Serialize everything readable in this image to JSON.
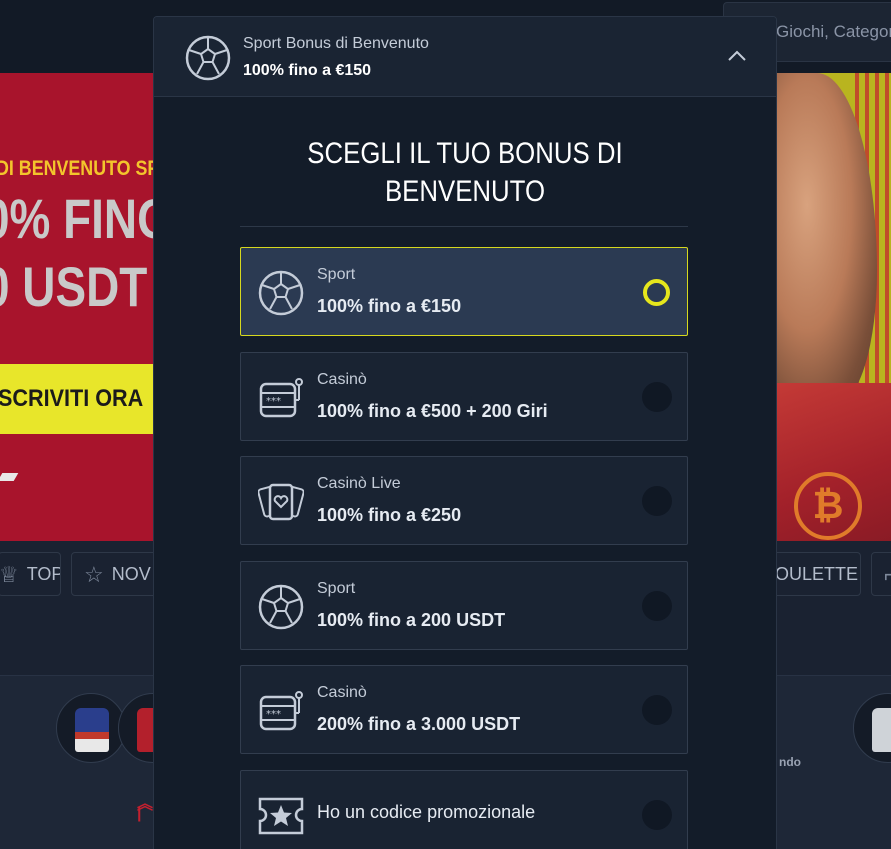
{
  "background": {
    "search_text": "Giochi, Categor",
    "banner": {
      "subtitle": "DI BENVENUTO SP",
      "line1": "0% FINO",
      "line2": "0 USDT",
      "cta": "SCRIVITI ORA"
    },
    "categories": [
      {
        "label": "TOP",
        "icon": "crown-icon"
      },
      {
        "label": "NOV",
        "icon": "star-icon"
      },
      {
        "label": "OULETTE",
        "icon": "roulette-icon"
      },
      {
        "label": "",
        "icon": "cards-icon"
      }
    ],
    "side_label": "ndo"
  },
  "modal": {
    "header": {
      "title": "Sport Bonus di Benvenuto",
      "subtitle": "100% fino a €150",
      "icon": "football-icon"
    },
    "heading_line1": "SCEGLI IL TUO BONUS DI",
    "heading_line2": "BENVENUTO",
    "options": [
      {
        "category": "Sport",
        "offer": "100% fino a €150",
        "icon": "football-icon",
        "selected": true
      },
      {
        "category": "Casinò",
        "offer": "100% fino a €500 + 200 Giri",
        "icon": "slot-machine-icon",
        "selected": false
      },
      {
        "category": "Casinò Live",
        "offer": "100% fino a €250",
        "icon": "playing-cards-icon",
        "selected": false
      },
      {
        "category": "Sport",
        "offer": "100% fino a 200 USDT",
        "icon": "football-icon",
        "selected": false
      },
      {
        "category": "Casinò",
        "offer": "200% fino a 3.000 USDT",
        "icon": "slot-machine-icon",
        "selected": false
      },
      {
        "label": "Ho un codice promozionale",
        "icon": "promo-ticket-icon",
        "selected": false
      }
    ]
  },
  "colors": {
    "accent_yellow": "#e6e61c",
    "modal_bg": "#131c29",
    "selected_bg": "#2b3a52",
    "banner_red": "#a8142c"
  }
}
